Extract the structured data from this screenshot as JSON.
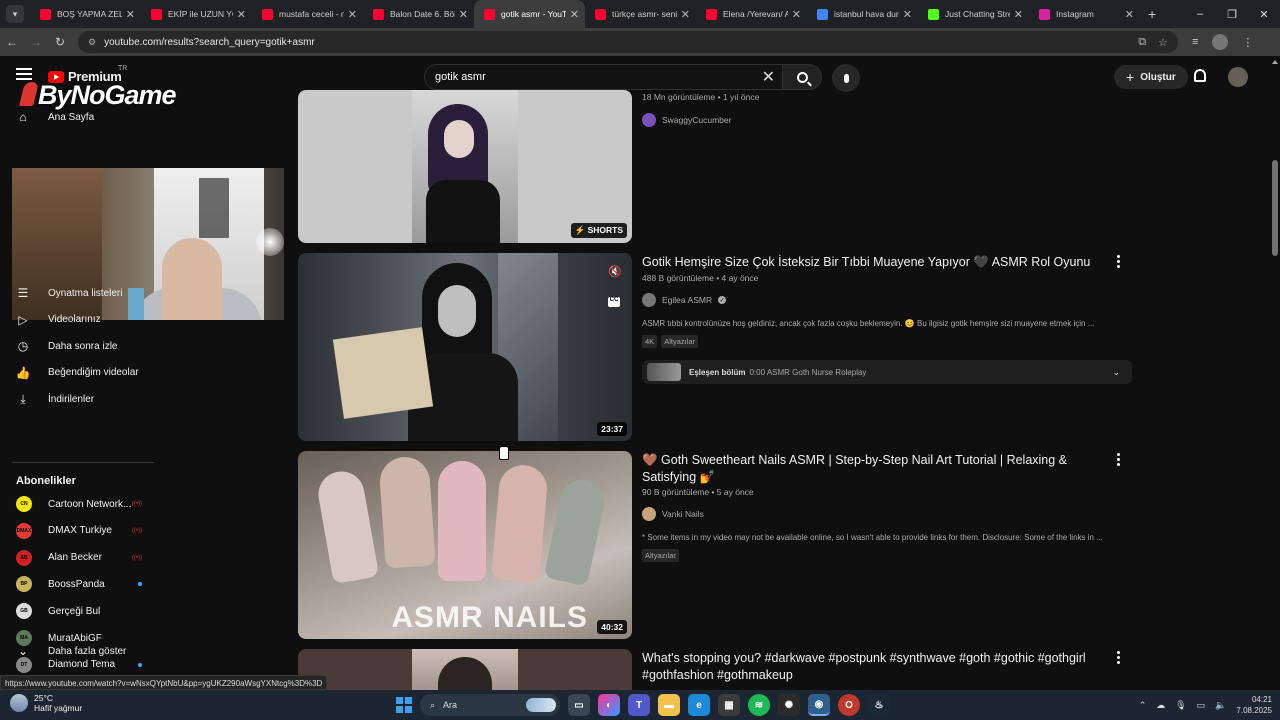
{
  "browser": {
    "tabs": [
      {
        "title": "BOŞ YAPMA ZELDA",
        "color": "#ff0033",
        "active": false
      },
      {
        "title": "EKİP ile UZUN YOL",
        "color": "#ff0033",
        "active": false
      },
      {
        "title": "mustafa ceceli - n",
        "color": "#ff0033",
        "active": false
      },
      {
        "title": "Balon Date 6. Böl",
        "color": "#ff0033",
        "active": false
      },
      {
        "title": "gotik asmr - YouT",
        "color": "#ff0033",
        "active": true
      },
      {
        "title": "türkçe asmr- seni",
        "color": "#ff0033",
        "active": false
      },
      {
        "title": "Elena /Yerevan/ A",
        "color": "#ff0033",
        "active": false
      },
      {
        "title": "istanbul hava dur",
        "color": "#4285f4",
        "active": false
      },
      {
        "title": "Just Chatting Stre",
        "color": "#53fc18",
        "active": false
      },
      {
        "title": "Instagram",
        "color": "#d6249f",
        "active": false
      }
    ],
    "url": "youtube.com/results?search_query=gotik+asmr",
    "status_url": "https://www.youtube.com/watch?v=wNsxQYptNbU&pp=ygUKZ290aWsgYXNtcg%3D%3D"
  },
  "header": {
    "logo_text": "Premium",
    "logo_region": "TR",
    "overlay_brand": "ByNoGame",
    "search_value": "gotik asmr",
    "create_label": "Oluştur"
  },
  "sidebar": {
    "home_label": "Ana Sayfa",
    "items": [
      {
        "label": "Oynatma listeleri",
        "icon": "playlist-icon"
      },
      {
        "label": "Videolarınız",
        "icon": "video-icon"
      },
      {
        "label": "Daha sonra izle",
        "icon": "clock-icon"
      },
      {
        "label": "Beğendiğim videolar",
        "icon": "thumbs-up-icon"
      },
      {
        "label": "İndirilenler",
        "icon": "download-icon"
      }
    ],
    "subs_heading": "Abonelikler",
    "subscriptions": [
      {
        "name": "Cartoon Network...",
        "color": "#f3e600",
        "abbr": "CN",
        "indicator": "live"
      },
      {
        "name": "DMAX Turkiye",
        "color": "#e53935",
        "abbr": "DMAX",
        "indicator": "live"
      },
      {
        "name": "Alan Becker",
        "color": "#cc2222",
        "abbr": "AB",
        "indicator": "live"
      },
      {
        "name": "BoossPanda",
        "color": "#c9b458",
        "abbr": "BP",
        "indicator": "dot"
      },
      {
        "name": "Gerçeği Bul",
        "color": "#dddddd",
        "abbr": "GB",
        "indicator": ""
      },
      {
        "name": "MuratAbiGF",
        "color": "#5a7a5a",
        "abbr": "MA",
        "indicator": ""
      },
      {
        "name": "Diamond Tema",
        "color": "#888888",
        "abbr": "DT",
        "indicator": "dot"
      }
    ],
    "show_more_label": "Daha fazla göster"
  },
  "results": [
    {
      "meta": "18 Mn görüntüleme • 1 yıl önce",
      "channel": "SwaggyCucumber",
      "channel_color": "#7b4fbf",
      "badge": "SHORTS"
    },
    {
      "title": "Gotik Hemşire Size Çok İsteksiz Bir Tıbbi Muayene Yapıyor 🖤 ASMR Rol Oyunu",
      "meta": "488 B görüntüleme • 4 ay önce",
      "channel": "Egilea ASMR",
      "channel_color": "#777777",
      "description": "ASMR tıbbi kontrolünüze hoş geldiniz, ancak çok fazla coşku beklemeyin. 😊 Bu ilgisiz gotik hemşire sizi muayene etmek için ...",
      "chips": [
        "4K",
        "Altyazılar"
      ],
      "chapter_label": "Eşleşen bölüm",
      "chapter_text": "0:00 ASMR Goth Nurse Roleplay",
      "duration": "23:37"
    },
    {
      "title": "🤎 Goth Sweetheart Nails ASMR | Step-by-Step Nail Art Tutorial | Relaxing & Satisfying 💅",
      "meta": "90 B görüntüleme • 5 ay önce",
      "channel": "Vanki Nails",
      "channel_color": "#c8a27a",
      "description": "* Some items in my video may not be available online, so I wasn't able to provide links for them. Disclosure: Some of the links in ...",
      "chips": [
        "Altyazılar"
      ],
      "duration": "40:32",
      "thumb_text": "ASMR NAILS"
    },
    {
      "title": "What's stopping you? #darkwave #postpunk #synthwave #goth #gothic #gothgirl #gothfashion #gothmakeup"
    }
  ],
  "taskbar": {
    "temperature": "25°C",
    "weather": "Hafif yağmur",
    "search_label": "Ara",
    "time": "04:21",
    "date": "7.08.2025"
  }
}
